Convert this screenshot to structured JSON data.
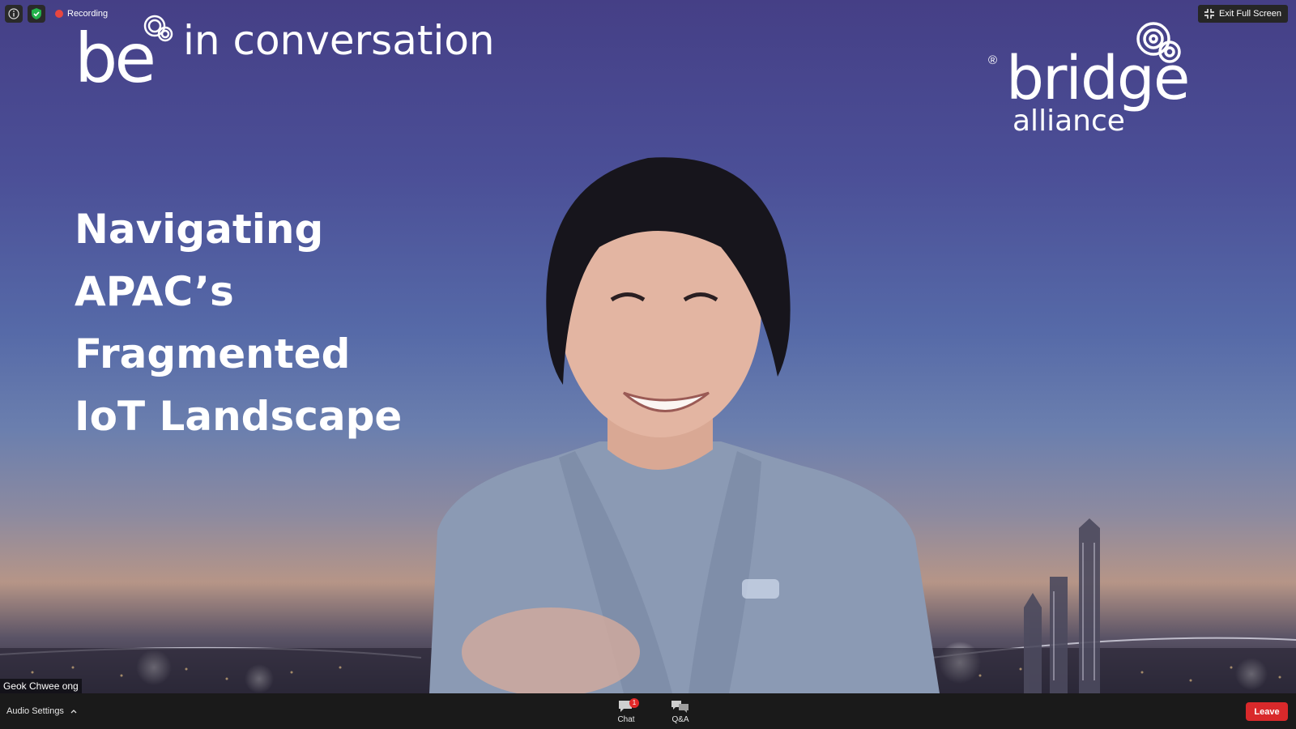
{
  "status": {
    "recording_label": "Recording"
  },
  "header_actions": {
    "exit_fullscreen_label": "Exit Full Screen"
  },
  "video": {
    "brand_be": "be",
    "brand_tagline": "in conversation",
    "slide_title_lines": [
      "Navigating",
      "APAC’s",
      "Fragmented",
      "IoT Landscape"
    ],
    "partner_logo": {
      "registered": "®",
      "wordmark": "bridge",
      "subtext": "alliance"
    },
    "participant_name": "Geok Chwee ong"
  },
  "toolbar": {
    "audio_settings_label": "Audio Settings",
    "chat_label": "Chat",
    "chat_badge": "1",
    "qa_label": "Q&A",
    "leave_label": "Leave"
  },
  "colors": {
    "leave_button": "#d9292b",
    "recording_dot": "#e8463f",
    "security_shield": "#23b24b"
  }
}
